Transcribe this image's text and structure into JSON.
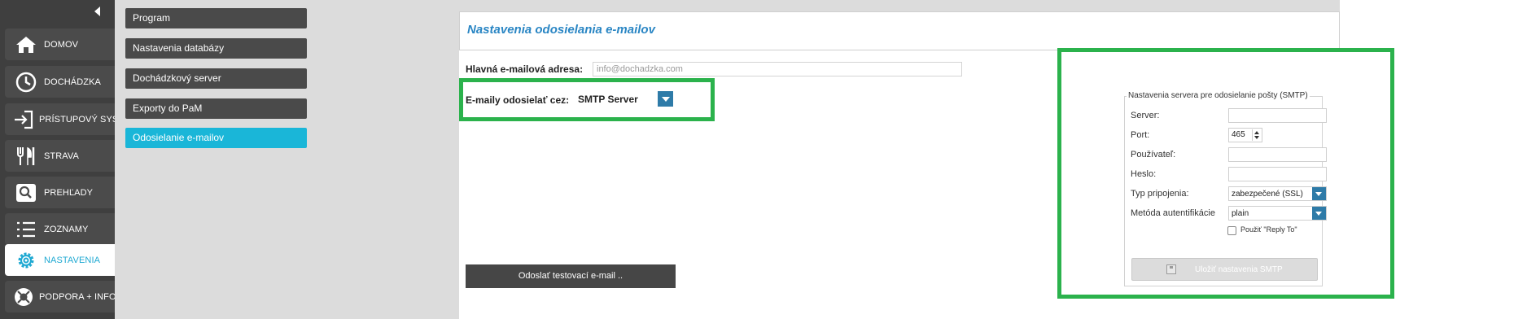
{
  "nav": {
    "items": [
      {
        "label": "DOMOV",
        "icon": "home-icon"
      },
      {
        "label": "DOCHÁDZKA",
        "icon": "clock-icon"
      },
      {
        "label": "PRÍSTUPOVÝ SYS.",
        "icon": "login-arrow-icon"
      },
      {
        "label": "STRAVA",
        "icon": "fork-knife-icon"
      },
      {
        "label": "PREHĽADY",
        "icon": "search-icon"
      },
      {
        "label": "ZOZNAMY",
        "icon": "list-icon"
      },
      {
        "label": "NASTAVENIA",
        "icon": "gear-icon",
        "active": true
      },
      {
        "label": "PODPORA + INFO",
        "icon": "lifebuoy-icon"
      }
    ]
  },
  "submenu": {
    "items": [
      {
        "label": "Program"
      },
      {
        "label": "Nastavenia databázy"
      },
      {
        "label": "Dochádzkový server"
      },
      {
        "label": "Exporty do PaM"
      },
      {
        "label": "Odosielanie e-mailov",
        "active": true
      }
    ]
  },
  "main": {
    "title": "Nastavenia odosielania e-mailov",
    "email_label": "Hlavná e-mailová adresa:",
    "email_placeholder": "info@dochadzka.com",
    "via_label": "E-maily odosielať cez:",
    "via_value": "SMTP Server",
    "test_button": "Odoslať testovací e-mail .."
  },
  "smtp": {
    "legend": "Nastavenia servera pre odosielanie pošty (SMTP)",
    "server_label": "Server:",
    "server_value": "",
    "port_label": "Port:",
    "port_value": "465",
    "user_label": "Používateľ:",
    "user_value": "",
    "password_label": "Heslo:",
    "password_value": "",
    "conn_label": "Typ pripojenia:",
    "conn_value": "zabezpečené (SSL)",
    "auth_label": "Metóda autentifikácie",
    "auth_value": "plain",
    "reply_to_label": "Použiť \"Reply To\"",
    "save_label": "Uložiť nastavenia SMTP"
  },
  "colors": {
    "accent": "#1ab6d8",
    "highlight": "#2bb24c",
    "title": "#2a86c4",
    "select_button": "#2e7ba8"
  }
}
